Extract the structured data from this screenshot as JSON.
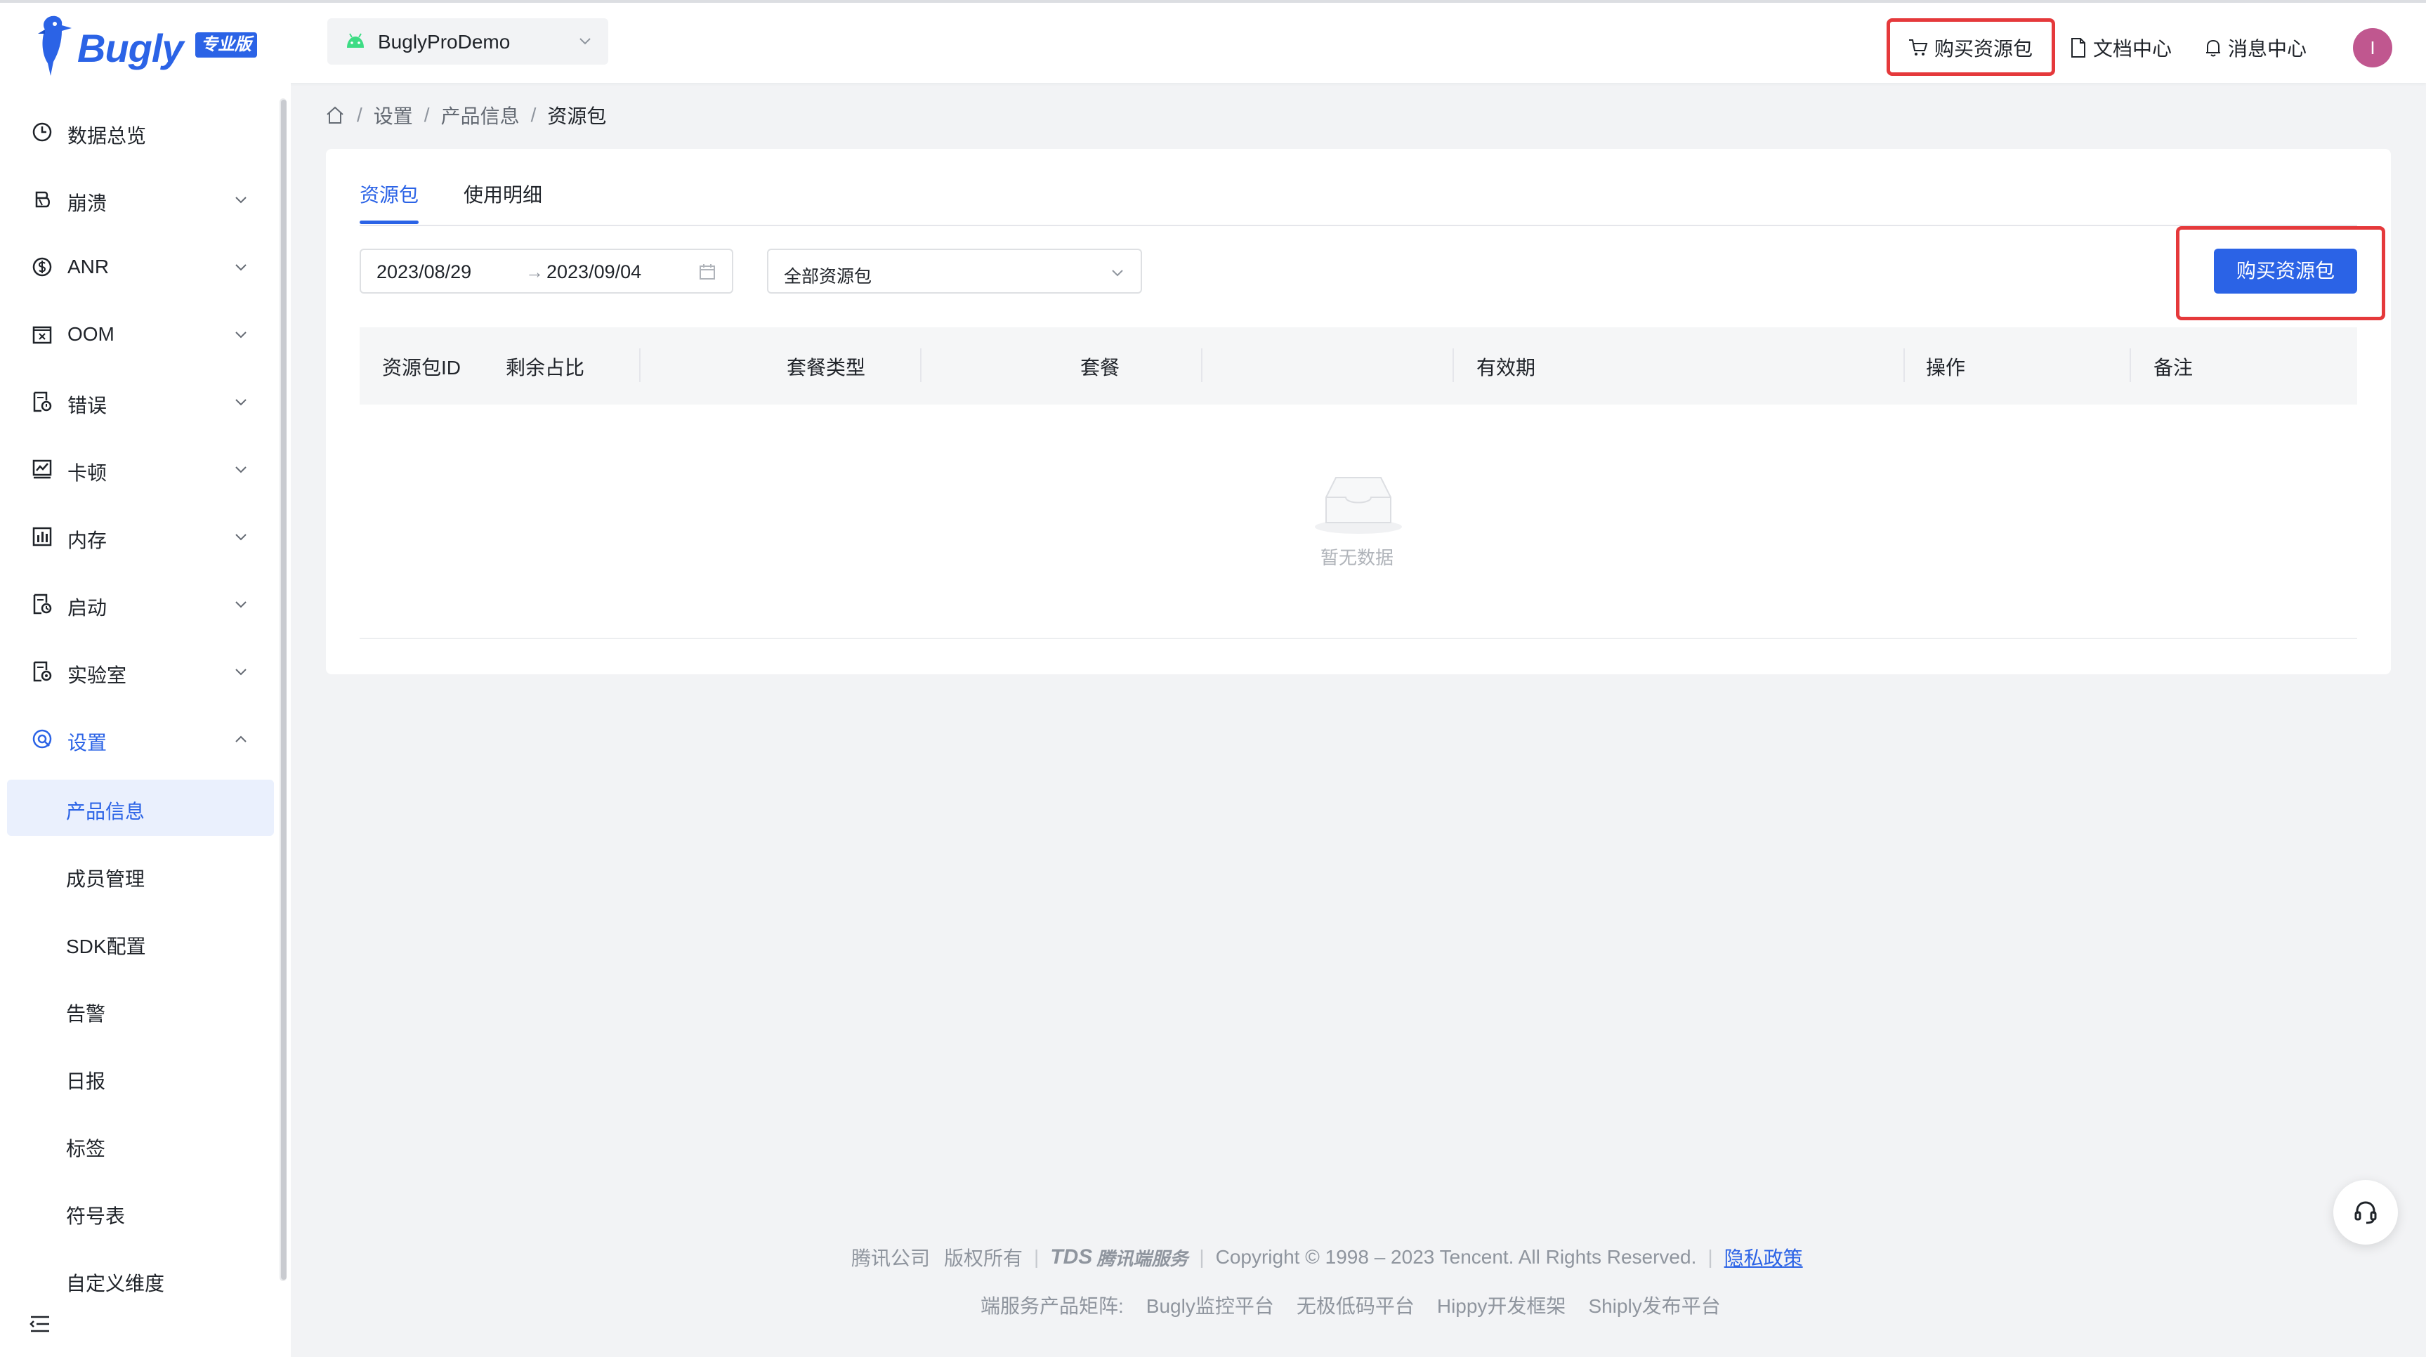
{
  "header": {
    "logo_text": "Bugly",
    "logo_badge": "专业版",
    "app_name": "BuglyProDemo",
    "buy_package": "购买资源包",
    "docs": "文档中心",
    "messages": "消息中心",
    "avatar_initial": "I"
  },
  "sidebar": {
    "menu": [
      {
        "label": "数据总览",
        "icon": "pie-chart-icon"
      },
      {
        "label": "崩溃",
        "icon": "bug-icon"
      },
      {
        "label": "ANR",
        "icon": "dollar-circle-icon"
      },
      {
        "label": "OOM",
        "icon": "memory-box-icon"
      },
      {
        "label": "错误",
        "icon": "error-doc-icon"
      },
      {
        "label": "卡顿",
        "icon": "line-chart-icon"
      },
      {
        "label": "内存",
        "icon": "bar-chart-icon"
      },
      {
        "label": "启动",
        "icon": "launch-doc-icon"
      },
      {
        "label": "实验室",
        "icon": "lab-doc-icon"
      },
      {
        "label": "设置",
        "icon": "settings-icon"
      }
    ],
    "settings_sub": [
      "产品信息",
      "成员管理",
      "SDK配置",
      "告警",
      "日报",
      "标签",
      "符号表",
      "自定义维度"
    ]
  },
  "breadcrumb": {
    "items": [
      "设置",
      "产品信息",
      "资源包"
    ]
  },
  "tabs": [
    "资源包",
    "使用明细"
  ],
  "filters": {
    "start_date": "2023/08/29",
    "end_date": "2023/09/04",
    "package_filter": "全部资源包",
    "buy_button": "购买资源包"
  },
  "table": {
    "columns": [
      "资源包ID",
      "剩余占比",
      "套餐类型",
      "套餐",
      "有效期",
      "操作",
      "备注"
    ],
    "empty_text": "暂无数据"
  },
  "footer": {
    "company": "腾讯公司",
    "rights": "版权所有",
    "tds_logo": "TDS",
    "tds_name": "腾讯端服务",
    "copyright": "Copyright © 1998 – 2023 Tencent. All Rights Reserved.",
    "privacy": "隐私政策",
    "matrix_label": "端服务产品矩阵:",
    "products": [
      "Bugly监控平台",
      "无极低码平台",
      "Hippy开发框架",
      "Shiply发布平台"
    ]
  },
  "colors": {
    "accent": "#2b63e6",
    "highlight": "#e5393b"
  }
}
